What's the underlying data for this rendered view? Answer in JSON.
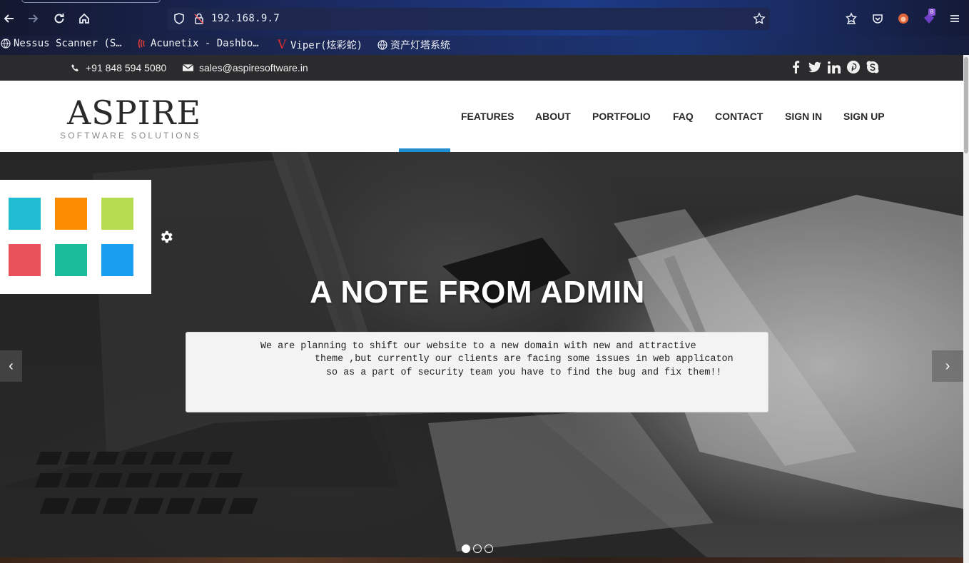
{
  "browser": {
    "url": "192.168.9.7",
    "extension_badge": "8",
    "bookmarks": [
      {
        "label": "Nessus Scanner (S…",
        "icon": "globe-icon"
      },
      {
        "label": "Acunetix - Dashbo…",
        "icon": "acunetix-icon"
      },
      {
        "label": "Viper(炫彩蛇)",
        "icon": "viper-icon"
      },
      {
        "label": "资产灯塔系统",
        "icon": "globe-icon"
      }
    ]
  },
  "topbar": {
    "phone": "+91 848 594 5080",
    "email": "sales@aspiresoftware.in",
    "socials": [
      "facebook-icon",
      "twitter-icon",
      "linkedin-icon",
      "pinterest-icon",
      "skype-icon"
    ]
  },
  "header": {
    "logo_title": "ASPIRE",
    "logo_subtitle": "SOFTWARE SOLUTIONS",
    "nav": [
      "FEATURES",
      "ABOUT",
      "PORTFOLIO",
      "FAQ",
      "CONTACT",
      "SIGN IN",
      "SIGN UP"
    ]
  },
  "hero": {
    "title": "A NOTE FROM ADMIN",
    "note_lines": [
      "We are planning to shift our website to a new domain with new and attractive",
      "theme ,but currently our clients are facing some issues in web applicaton",
      "so as a part of security team you have to find the bug and fix them!!"
    ],
    "prev_label": "‹",
    "next_label": "›",
    "slides": 3,
    "active_slide": 1
  },
  "theme_swatches": [
    "#1fbcd2",
    "#fd8c00",
    "#b7dc51",
    "#e9525b",
    "#1abc9c",
    "#1a9ff0"
  ]
}
